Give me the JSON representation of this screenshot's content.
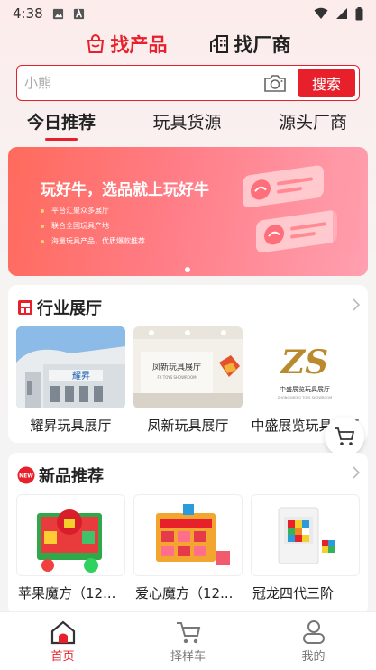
{
  "status_bar": {
    "time": "4:38"
  },
  "switcher": {
    "product": "找产品",
    "factory": "找厂商"
  },
  "search": {
    "placeholder": "小熊",
    "button": "搜索"
  },
  "tabs": [
    {
      "label": "今日推荐",
      "active": true
    },
    {
      "label": "玩具货源",
      "active": false
    },
    {
      "label": "源头厂商",
      "active": false
    }
  ],
  "banner": {
    "title": "玩好牛，选品就上玩好牛",
    "bullets": [
      "平台汇聚众多展厅",
      "联合全国玩具产地",
      "海量玩具产品，优质爆款推荐"
    ]
  },
  "hall_section": {
    "title": "行业展厅",
    "items": [
      {
        "name": "耀昇玩具展厅",
        "sign": "耀昇"
      },
      {
        "name": "凤新玩具展厅",
        "sign": "凤新玩具展厅",
        "sign_sub": "FX TOYS SHOWROOM"
      },
      {
        "name": "中盛展览玩具展厅",
        "logo": "ZS",
        "logo_caption": "中盛展览玩具展厅",
        "logo_sub": "ZHONGSHENG TOYS SHOWROOM"
      }
    ]
  },
  "new_section": {
    "title": "新品推荐",
    "badge": "NEW",
    "items": [
      {
        "name": "苹果魔方（12..."
      },
      {
        "name": "爱心魔方（12..."
      },
      {
        "name": "冠龙四代三阶"
      }
    ]
  },
  "bottom_nav": [
    {
      "label": "首页",
      "icon": "home-icon",
      "active": true
    },
    {
      "label": "择样车",
      "icon": "cart-icon",
      "active": false
    },
    {
      "label": "我的",
      "icon": "profile-icon",
      "active": false
    }
  ],
  "colors": {
    "accent": "#e8202c",
    "banner": "#ff7373"
  }
}
